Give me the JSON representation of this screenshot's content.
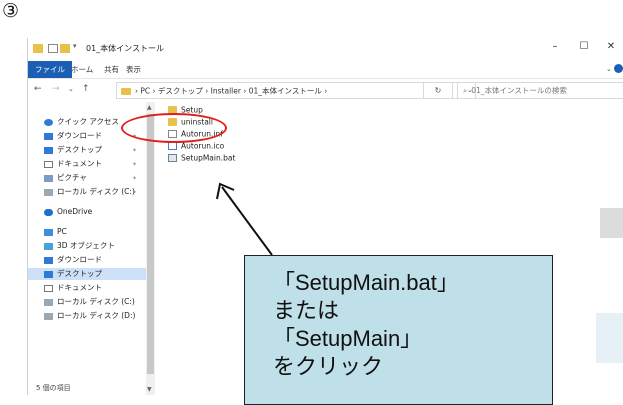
{
  "step_marker": "③",
  "window": {
    "title": "01_本体インストール",
    "controls": {
      "minimize": "–",
      "maximize": "☐",
      "close": "✕"
    }
  },
  "ribbon": {
    "tabs": [
      "ファイル",
      "ホーム",
      "共有",
      "表示"
    ]
  },
  "address": {
    "path": "› PC › デスクトップ › Installer › 01_本体インストール ›",
    "search_placeholder": "01_本体インストールの検索"
  },
  "nav_pane": {
    "items": [
      {
        "label": "クイック アクセス",
        "icon": "star-icon",
        "pinned": false
      },
      {
        "label": "ダウンロード",
        "icon": "download-icon",
        "pinned": true
      },
      {
        "label": "デスクトップ",
        "icon": "desktop-icon",
        "pinned": true
      },
      {
        "label": "ドキュメント",
        "icon": "document-icon",
        "pinned": true
      },
      {
        "label": "ピクチャ",
        "icon": "picture-icon",
        "pinned": true
      },
      {
        "label": "ローカル ディスク (C:)",
        "icon": "drive-icon",
        "pinned": true
      },
      {
        "label": "OneDrive",
        "icon": "cloud-icon",
        "pinned": false
      },
      {
        "label": "PC",
        "icon": "pc-icon",
        "pinned": false
      },
      {
        "label": "3D オブジェクト",
        "icon": "cube-icon",
        "pinned": false
      },
      {
        "label": "ダウンロード",
        "icon": "download-icon",
        "pinned": false
      },
      {
        "label": "デスクトップ",
        "icon": "desktop-icon",
        "pinned": false,
        "selected": true
      },
      {
        "label": "ドキュメント",
        "icon": "document-icon",
        "pinned": false
      },
      {
        "label": "ローカル ディスク (C:)",
        "icon": "drive-icon",
        "pinned": false
      },
      {
        "label": "ローカル ディスク (D:)",
        "icon": "drive-icon",
        "pinned": false
      }
    ]
  },
  "files": [
    {
      "name": "Setup",
      "type": "folder"
    },
    {
      "name": "uninstall",
      "type": "folder"
    },
    {
      "name": "Autorun.inf",
      "type": "settings"
    },
    {
      "name": "Autorun.ico",
      "type": "icon-file"
    },
    {
      "name": "SetupMain.bat",
      "type": "batch"
    }
  ],
  "status_bar": {
    "item_count": "5 個の項目"
  },
  "callout": {
    "lines": [
      "「SetupMain.bat」",
      "または",
      "「SetupMain」",
      "をクリック"
    ]
  },
  "colors": {
    "accent": "#1a5fb4",
    "selection": "#cce0f7",
    "highlight_ring": "#e02020",
    "callout_fill": "#bfe0e8"
  }
}
